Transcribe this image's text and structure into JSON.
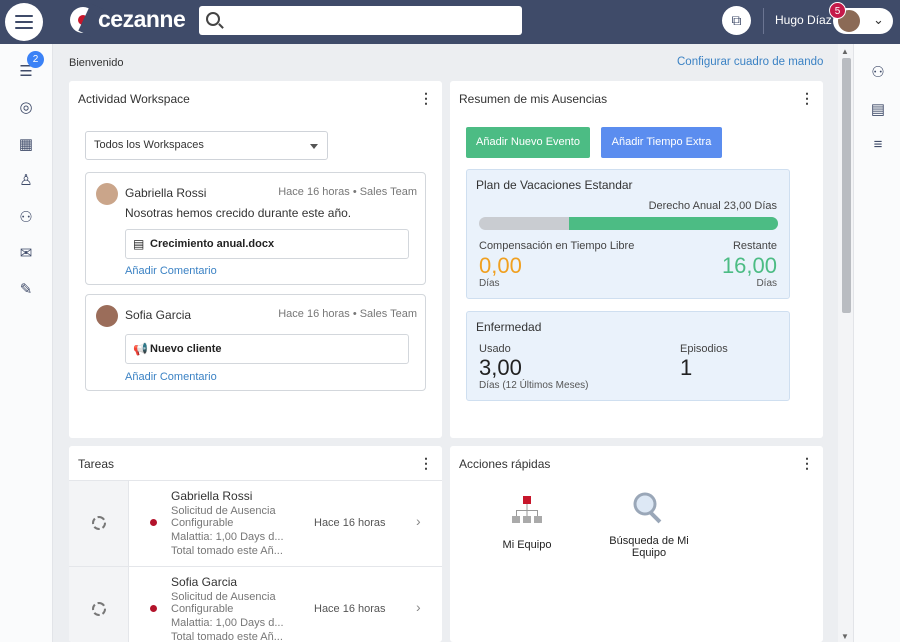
{
  "header": {
    "logo_text": "cezanne",
    "search_placeholder": "",
    "user_name": "Hugo Díaz",
    "notification_count": "5"
  },
  "sidebar": {
    "badge": "2",
    "icons": [
      "task-list-icon",
      "radar-icon",
      "calendar-icon",
      "person-icon",
      "team-icon",
      "chat-icon",
      "wrench-icon"
    ]
  },
  "page": {
    "greeting": "Bienvenido",
    "configure_link": "Configurar cuadro de mando"
  },
  "workspace": {
    "title": "Actividad Workspace",
    "filter_value": "Todos los Workspaces",
    "posts": [
      {
        "author": "Gabriella Rossi",
        "meta": "Hace 16 horas • Sales Team",
        "text": "Nosotras hemos crecido durante este año.",
        "attachment": "Crecimiento anual.docx",
        "comment_link": "Añadir Comentario"
      },
      {
        "author": "Sofia Garcia",
        "meta": "Hace 16 horas • Sales Team",
        "text": "",
        "attachment": "Nuevo cliente",
        "comment_link": "Añadir Comentario"
      }
    ]
  },
  "absences": {
    "title": "Resumen de mis Ausencias",
    "add_event_label": "Añadir Nuevo Evento",
    "add_overtime_label": "Añadir Tiempo Extra",
    "vacation": {
      "title": "Plan de Vacaciones Estandar",
      "entitlement": "Derecho Anual 23,00 Días",
      "toil_label": "Compensación en Tiempo Libre",
      "toil_value": "0,00",
      "toil_unit": "Días",
      "remaining_label": "Restante",
      "remaining_value": "16,00",
      "remaining_unit": "Días",
      "remaining_fraction": 0.7
    },
    "sickness": {
      "title": "Enfermedad",
      "used_label": "Usado",
      "used_value": "3,00",
      "used_unit": "Días (12 Últimos Meses)",
      "episodes_label": "Episodios",
      "episodes_value": "1"
    }
  },
  "tasks": {
    "title": "Tareas",
    "items": [
      {
        "name": "Gabriella Rossi",
        "line1": "Solicitud de Ausencia",
        "line2": "Configurable",
        "line3": "Malattia: 1,00 Days d...",
        "line4": "Total tomado este Añ...",
        "time": "Hace 16 horas"
      },
      {
        "name": "Sofia Garcia",
        "line1": "Solicitud de Ausencia",
        "line2": "Configurable",
        "line3": "Malattia: 1,00 Days d...",
        "line4": "Total tomado este Añ...",
        "time": "Hace 16 horas"
      }
    ]
  },
  "quick_actions": {
    "title": "Acciones rápidas",
    "items": [
      {
        "label": "Mi Equipo"
      },
      {
        "label_line1": "Búsqueda de Mi",
        "label_line2": "Equipo"
      }
    ]
  },
  "colors": {
    "header": "#3f4b69",
    "green": "#4cbc84",
    "blue": "#5b8def",
    "orange": "#f0a020",
    "link": "#3b82c4"
  }
}
